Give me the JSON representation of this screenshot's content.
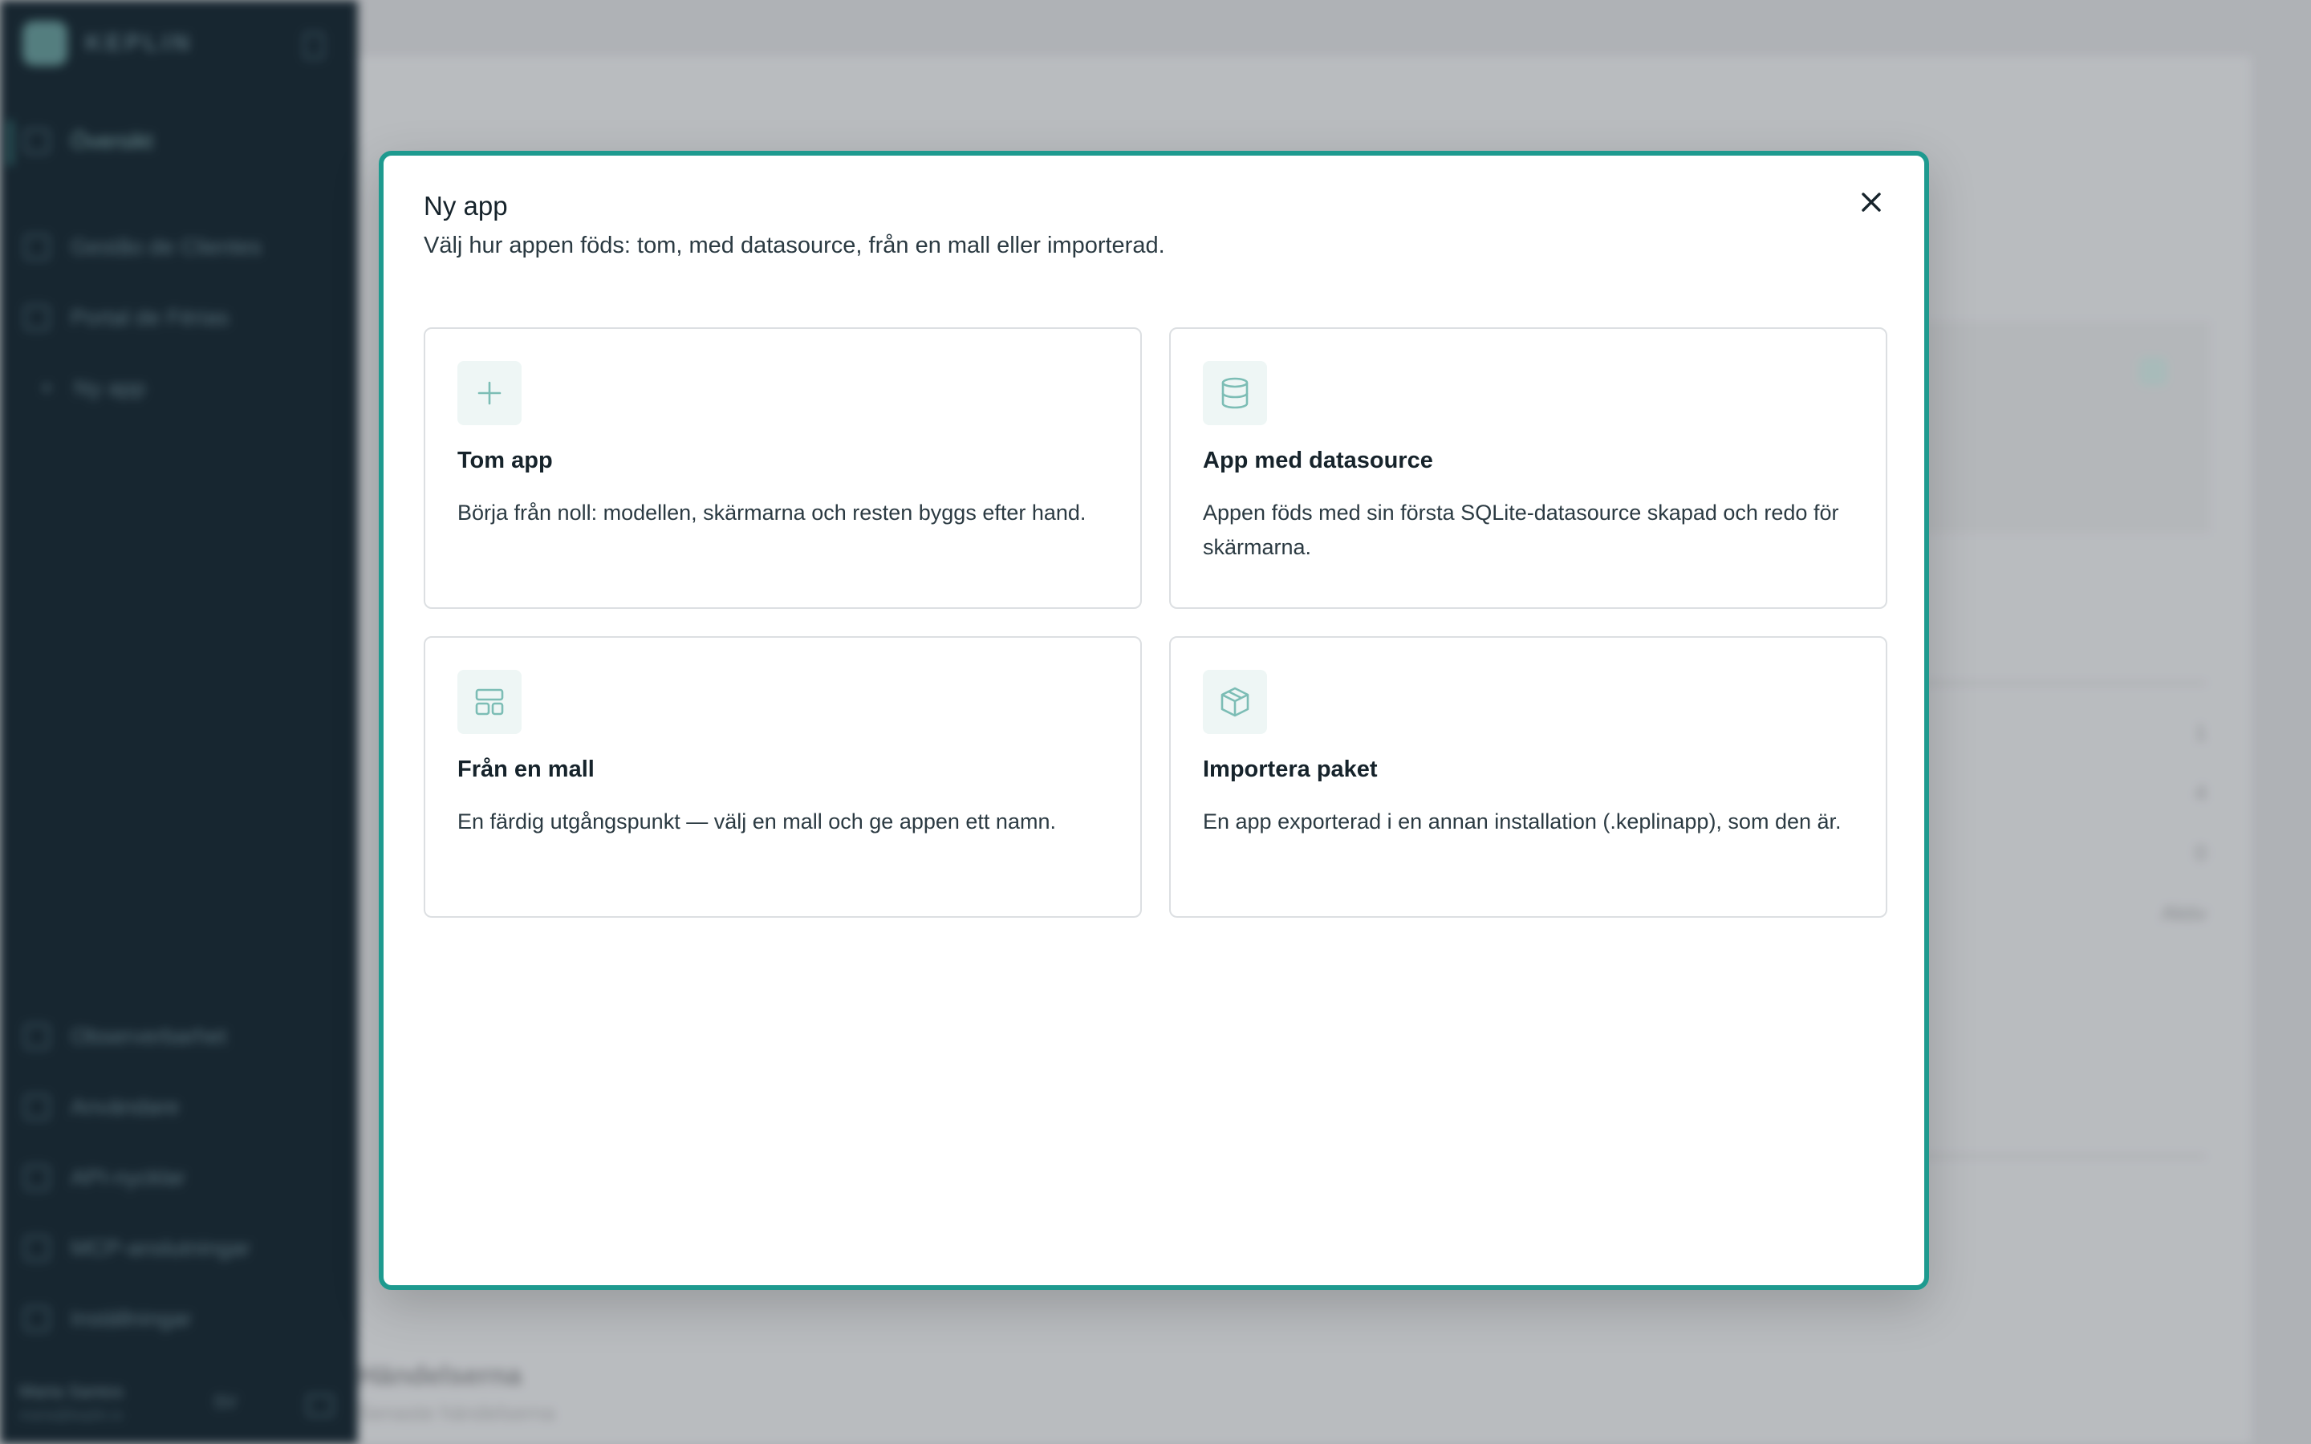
{
  "background": {
    "brand": {
      "name": "KEPLIN"
    },
    "nav": {
      "overview": "Översikt",
      "items": [
        "Gestão de Clientes",
        "Portal de Férias",
        "Ny app"
      ],
      "bottom_items": [
        "Observerbarhet",
        "Användare",
        "API-nycklar",
        "MCP-anslutningar",
        "Inställningar"
      ]
    },
    "user": {
      "name": "Maria Santos",
      "email": "maria@keplin.io",
      "lang": "SV"
    },
    "right_values": [
      "1",
      "4",
      "0",
      "Aktiv"
    ],
    "bottom_title": "Händelserna",
    "bottom_subtitle": "Senaste händelserna"
  },
  "modal": {
    "title": "Ny app",
    "subtitle": "Välj hur appen föds: tom, med datasource, från en mall eller importerad.",
    "close_icon": "close-icon",
    "options": [
      {
        "icon": "plus-icon",
        "title": "Tom app",
        "description": "Börja från noll: modellen, skärmarna och resten byggs efter hand."
      },
      {
        "icon": "database-icon",
        "title": "App med datasource",
        "description": "Appen föds med sin första SQLite-datasource skapad och redo för skärmarna."
      },
      {
        "icon": "template-icon",
        "title": "Från en mall",
        "description": "En färdig utgångspunkt — välj en mall och ge appen ett namn."
      },
      {
        "icon": "package-icon",
        "title": "Importera paket",
        "description": "En app exporterad i en annan installation (.keplinapp), som den är."
      }
    ]
  },
  "colors": {
    "accent": "#1e9a8f",
    "sidebar": "#0f202b",
    "icon_tint": "#7cbdb5"
  }
}
